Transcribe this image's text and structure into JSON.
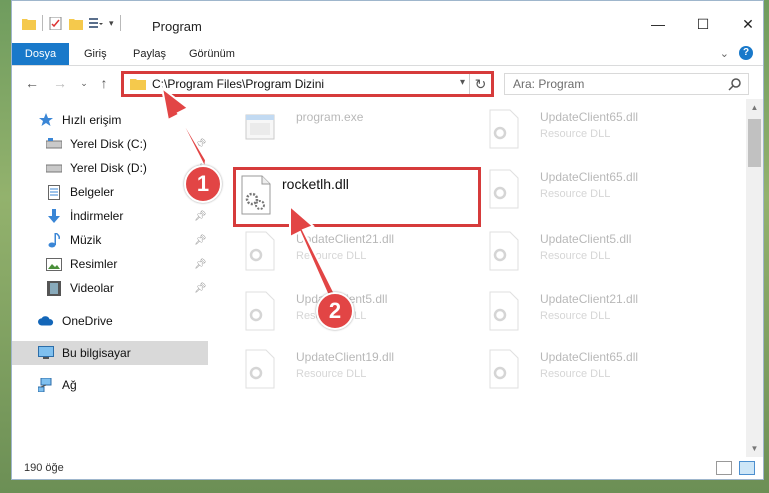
{
  "window": {
    "title": "Program",
    "minimize_label": "—",
    "maximize_label": "☐",
    "close_label": "✕"
  },
  "ribbon": {
    "tabs": [
      "Dosya",
      "Giriş",
      "Paylaş",
      "Görünüm"
    ],
    "expand_icon": "chevron-down-icon",
    "help_label": "?"
  },
  "navigation": {
    "address_path": "C:\\Program Files\\Program Dizini",
    "search_placeholder": "Ara: Program"
  },
  "sidebar": {
    "items": [
      {
        "label": "Hızlı erişim",
        "icon": "star-icon"
      },
      {
        "label": "Yerel Disk (C:)",
        "icon": "drive-icon",
        "pinned": true
      },
      {
        "label": "Yerel Disk (D:)",
        "icon": "drive-icon",
        "pinned": true
      },
      {
        "label": "Belgeler",
        "icon": "documents-icon",
        "pinned": true
      },
      {
        "label": "İndirmeler",
        "icon": "download-icon",
        "pinned": true
      },
      {
        "label": "Müzik",
        "icon": "music-icon",
        "pinned": true
      },
      {
        "label": "Resimler",
        "icon": "pictures-icon",
        "pinned": true
      },
      {
        "label": "Videolar",
        "icon": "video-icon",
        "pinned": true
      },
      {
        "label": "OneDrive",
        "icon": "cloud-icon"
      },
      {
        "label": "Bu bilgisayar",
        "icon": "computer-icon",
        "selected": true
      },
      {
        "label": "Ağ",
        "icon": "network-icon"
      }
    ]
  },
  "files": {
    "left_column": [
      {
        "name": "program.exe",
        "type": ""
      },
      {
        "name": "rocketlh.dll",
        "type": ""
      },
      {
        "name": "UpdateClient21.dll",
        "type": "Resource DLL"
      },
      {
        "name": "UpdateClient5.dll",
        "type": "Resource DLL"
      },
      {
        "name": "UpdateClient19.dll",
        "type": "Resource DLL"
      }
    ],
    "right_column": [
      {
        "name": "UpdateClient65.dll",
        "type": "Resource DLL"
      },
      {
        "name": "UpdateClient65.dll",
        "type": "Resource DLL"
      },
      {
        "name": "UpdateClient5.dll",
        "type": "Resource DLL"
      },
      {
        "name": "UpdateClient21.dll",
        "type": "Resource DLL"
      },
      {
        "name": "UpdateClient65.dll",
        "type": "Resource DLL"
      }
    ]
  },
  "status": {
    "item_count": "190 öğe"
  },
  "annotations": {
    "step1": "1",
    "step2": "2"
  },
  "colors": {
    "accent": "#1979ca",
    "highlight": "#d63b3b",
    "arrow": "#e24545"
  }
}
